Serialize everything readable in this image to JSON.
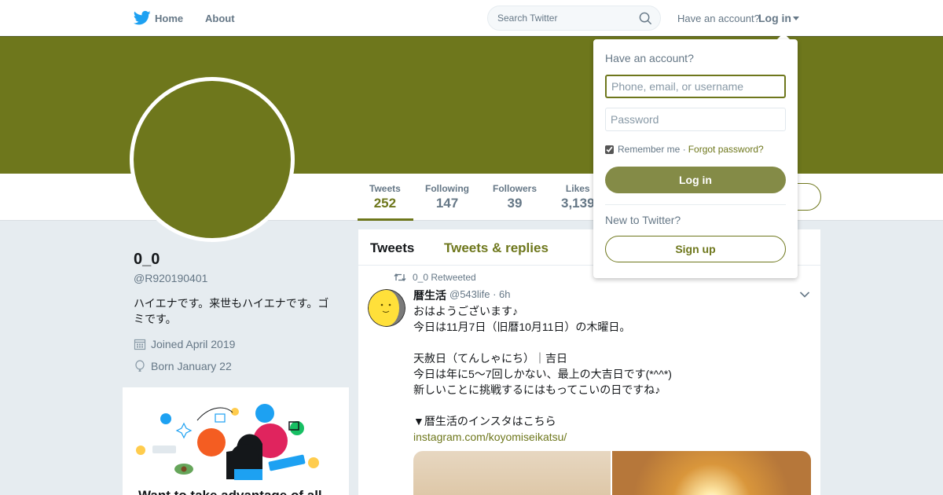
{
  "nav": {
    "home_label": "Home",
    "about_label": "About",
    "search_placeholder": "Search Twitter",
    "have_account": "Have an account?",
    "login_label": "Log in"
  },
  "colors": {
    "theme": "#6e771c",
    "background": "#e6ecf0"
  },
  "profile": {
    "name": "0_0",
    "handle": "@R920190401",
    "bio": "ハイエナです。来世もハイエナです。ゴミです。",
    "joined": "Joined April 2019",
    "born": "Born January 22"
  },
  "stats": [
    {
      "label": "Tweets",
      "value": "252"
    },
    {
      "label": "Following",
      "value": "147"
    },
    {
      "label": "Followers",
      "value": "39"
    },
    {
      "label": "Likes",
      "value": "3,139"
    }
  ],
  "promo": {
    "text": "Want to take advantage of all"
  },
  "timeline": {
    "tabs": [
      "Tweets",
      "Tweets & replies"
    ],
    "tweet": {
      "retweet_by": "0_0 Retweeted",
      "author": "暦生活",
      "handle_time": "@543life · 6h",
      "lines": [
        "おはようございます♪",
        "今日は11月7日（旧暦10月11日）の木曜日。",
        "",
        "天赦日（てんしゃにち）｜吉日",
        "今日は年に5〜7回しかない、最上の大吉日です(*^^*)",
        "新しいことに挑戦するにはもってこいの日ですね♪",
        "",
        "▼暦生活のインスタはこちら"
      ],
      "link": "instagram.com/koyomiseikatsu/"
    }
  },
  "login_dropdown": {
    "title": "Have an account?",
    "username_placeholder": "Phone, email, or username",
    "password_placeholder": "Password",
    "remember_label": "Remember me ·",
    "forgot_label": "Forgot password?",
    "login_button": "Log in",
    "new_label": "New to Twitter?",
    "signup_button": "Sign up"
  }
}
